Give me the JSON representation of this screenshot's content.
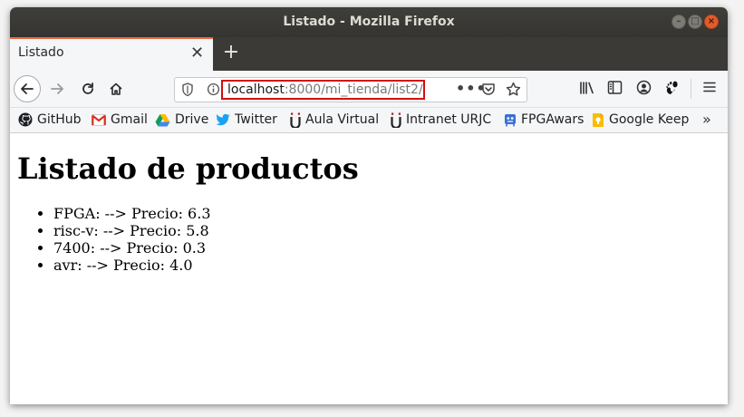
{
  "window": {
    "title": "Listado - Mozilla Firefox"
  },
  "tab": {
    "label": "Listado",
    "close": "✕"
  },
  "newtab": {
    "label": "+"
  },
  "urlbar": {
    "host": "localhost",
    "rest": ":8000/mi_tienda/list2/",
    "more": "•••"
  },
  "bookmarks": [
    {
      "label": "GitHub",
      "icon": "github-icon"
    },
    {
      "label": "Gmail",
      "icon": "gmail-icon"
    },
    {
      "label": "Drive",
      "icon": "drive-icon"
    },
    {
      "label": "Twitter",
      "icon": "twitter-icon"
    },
    {
      "label": "Aula Virtual",
      "icon": "urjc-icon"
    },
    {
      "label": "Intranet URJC",
      "icon": "urjc-icon"
    },
    {
      "label": "FPGAwars",
      "icon": "fpgawars-icon"
    },
    {
      "label": "Google Keep",
      "icon": "keep-icon"
    }
  ],
  "bookmarks_overflow": "»",
  "page": {
    "heading": "Listado de productos",
    "products": [
      "FPGA: --> Precio: 6.3",
      "risc-v: --> Precio: 5.8",
      "7400: --> Precio: 0.3",
      "avr: --> Precio: 4.0"
    ]
  },
  "colors": {
    "accent_tab": "#e66a3e",
    "url_highlight": "#d20f0f",
    "titlebar": "#3b3a37"
  }
}
